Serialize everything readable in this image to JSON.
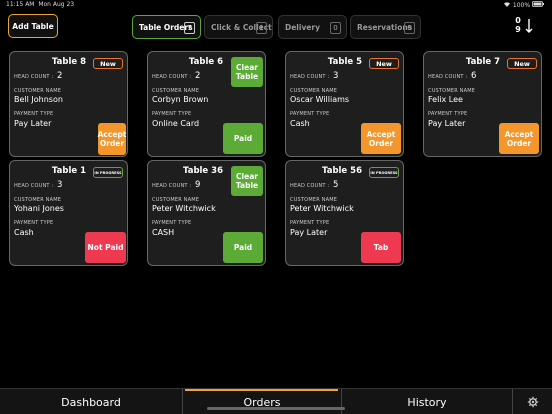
{
  "status": {
    "time": "11:15 AM",
    "date": "Mon Aug 23",
    "battery": "100%"
  },
  "toolbar": {
    "add_table": "Add Table"
  },
  "filters": [
    {
      "label": "Table Orders",
      "count": "7"
    },
    {
      "label": "Click & Collect",
      "count": "1"
    },
    {
      "label": "Delivery",
      "count": "0"
    },
    {
      "label": "Reservations",
      "count": "0"
    }
  ],
  "sort": {
    "top": "0",
    "bottom": "9"
  },
  "labels": {
    "head_count": "HEAD COUNT :",
    "customer_name": "CUSTOMER NAME",
    "payment_type": "PAYMENT TYPE"
  },
  "cards": [
    {
      "title": "Table 8",
      "head_count": "2",
      "customer": "Bell Johnson",
      "payment": "Pay Later",
      "badge": "New",
      "action": "Accept Order"
    },
    {
      "title": "Table 6",
      "head_count": "2",
      "customer": "Corbyn Brown",
      "payment": "Online Card",
      "top_action": "Clear Table",
      "action": "Paid"
    },
    {
      "title": "Table 5",
      "head_count": "3",
      "customer": "Oscar Williams",
      "payment": "Cash",
      "badge": "New",
      "action": "Accept Order"
    },
    {
      "title": "Table 7",
      "head_count": "6",
      "customer": "Felix Lee",
      "payment": "Pay Later",
      "badge": "New",
      "action": "Accept Order"
    },
    {
      "title": "Table 1",
      "head_count": "3",
      "customer": "Yohani Jones",
      "payment": "Cash",
      "badge": "IN PROGRESS",
      "action": "Not Paid"
    },
    {
      "title": "Table 36",
      "head_count": "9",
      "customer": "Peter Witchwick",
      "payment": "CASH",
      "top_action": "Clear Table",
      "action": "Paid"
    },
    {
      "title": "Table 56",
      "head_count": "5",
      "customer": "Peter Witchwick",
      "payment": "Pay Later",
      "badge": "IN PROGRESS",
      "action": "Tab"
    }
  ],
  "nav": {
    "dashboard": "Dashboard",
    "orders": "Orders",
    "history": "History"
  },
  "colors": {
    "accent": "#e8a63a",
    "orange": "#f4962b",
    "green": "#5cab36",
    "red": "#ee3951"
  }
}
